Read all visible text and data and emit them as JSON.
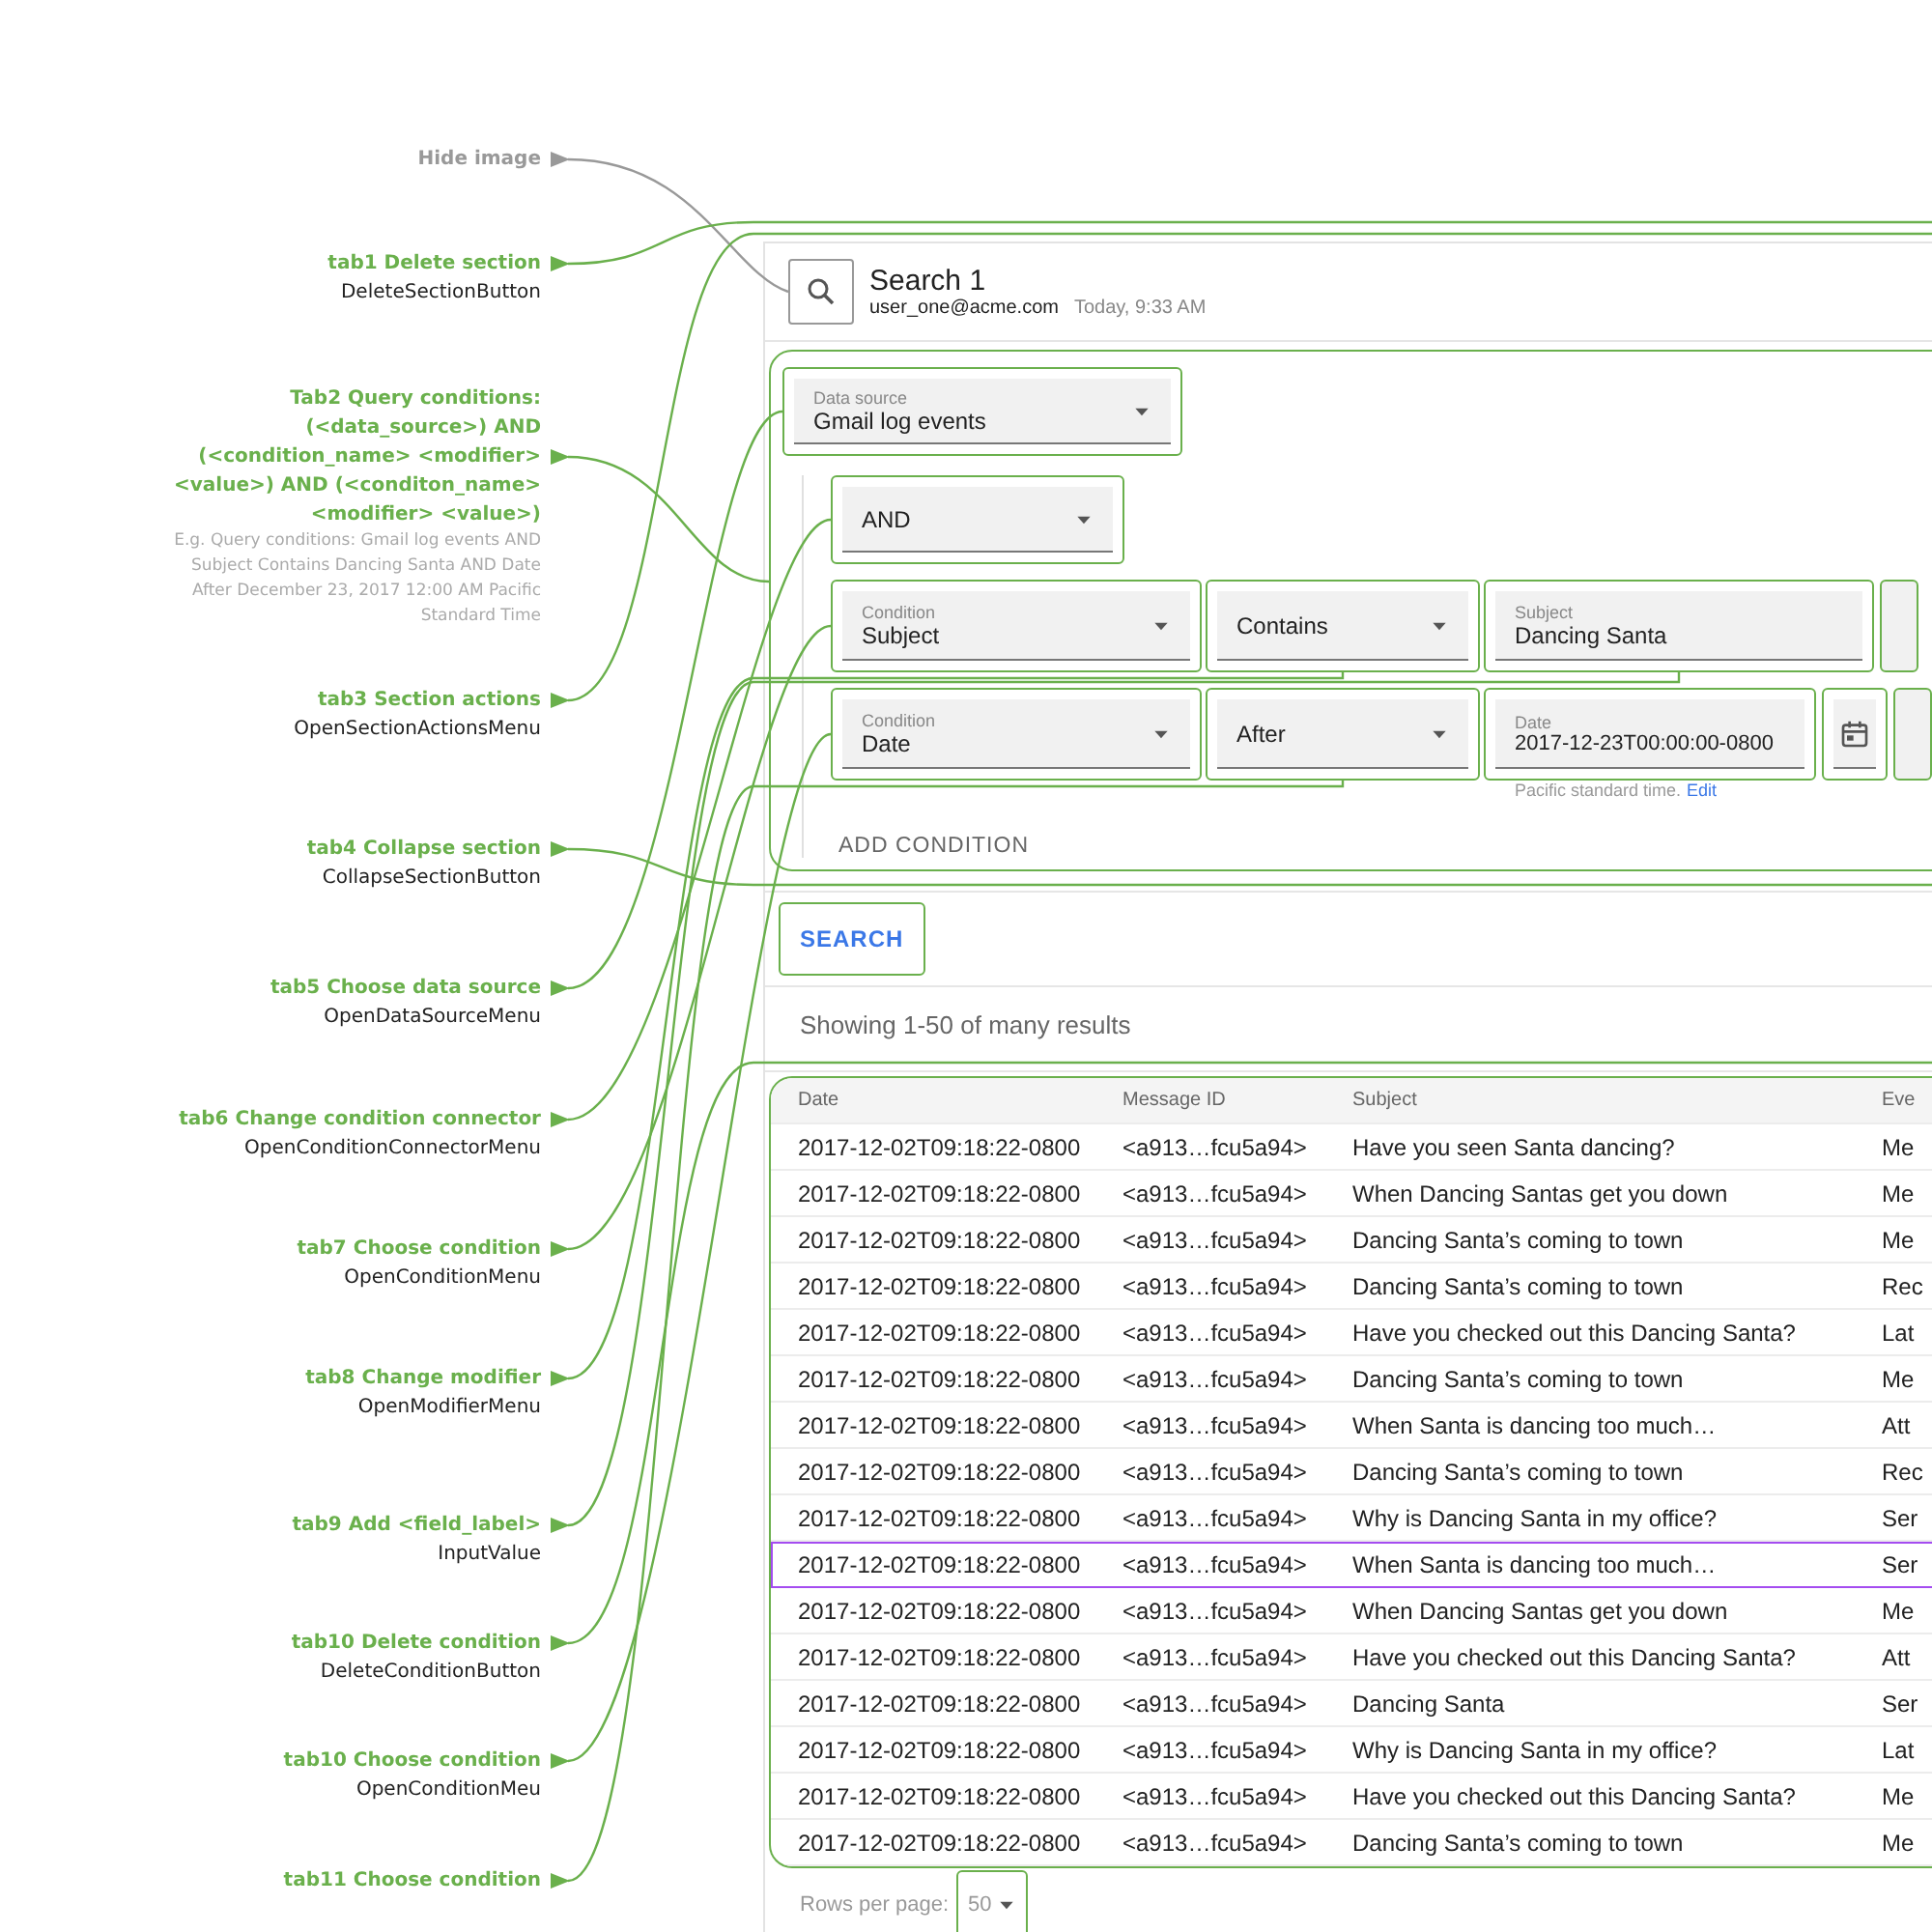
{
  "annotations": [
    {
      "kind": "hint",
      "title": "Hide image"
    },
    {
      "kind": "spec",
      "title": "tab1 Delete section",
      "code": "DeleteSectionButton"
    },
    {
      "kind": "spec",
      "title": "Tab2 Query conditions: (<data_source>) AND (<condition_name> <modifier> <value>) AND (<conditon_name> <modifier> <value>)",
      "description": "E.g. Query conditions: Gmail log events AND Subject Contains Dancing Santa AND Date After December 23, 2017 12:00 AM Pacific Standard Time"
    },
    {
      "kind": "spec",
      "title": "tab3  Section actions",
      "code": "OpenSectionActionsMenu"
    },
    {
      "kind": "spec",
      "title": "tab4 Collapse section",
      "code": "CollapseSectionButton"
    },
    {
      "kind": "spec",
      "title": "tab5 Choose data source",
      "code": "OpenDataSourceMenu"
    },
    {
      "kind": "spec",
      "title": "tab6 Change condition connector",
      "code": "OpenConditionConnectorMenu"
    },
    {
      "kind": "spec",
      "title": "tab7 Choose condition",
      "code": "OpenConditionMenu"
    },
    {
      "kind": "spec",
      "title": "tab8 Change modifier",
      "code": "OpenModifierMenu"
    },
    {
      "kind": "spec",
      "title": "tab9 Add <field_label>",
      "code": "InputValue"
    },
    {
      "kind": "spec",
      "title": "tab10 Delete condition",
      "code": "DeleteConditionButton"
    },
    {
      "kind": "spec",
      "title": "tab10 Choose condition",
      "code": "OpenConditionMeu"
    },
    {
      "kind": "spec",
      "title": "tab11 Choose condition"
    }
  ],
  "search": {
    "title": "Search 1",
    "user": "user_one@acme.com",
    "time": "Today, 9:33 AM"
  },
  "data_source": {
    "label": "Data source",
    "value": "Gmail log events"
  },
  "connector": {
    "value": "AND"
  },
  "conditions": [
    {
      "kind": "text",
      "condition_label": "Condition",
      "condition": "Subject",
      "modifier": "Contains",
      "value_label": "Subject",
      "value": "Dancing Santa"
    },
    {
      "kind": "date",
      "condition_label": "Condition",
      "condition": "Date",
      "modifier": "After",
      "value_label": "Date",
      "value": "2017-12-23T00:00:00-0800",
      "hint": "Pacific standard time.",
      "hint_link": "Edit"
    }
  ],
  "add_condition": "ADD CONDITION",
  "search_button": "SEARCH",
  "results_summary": "Showing 1-50 of many results",
  "table": {
    "columns": [
      "Date",
      "Message ID",
      "Subject",
      "Eve"
    ],
    "rows": [
      {
        "selected": false,
        "cells": [
          "2017-12-02T09:18:22-0800",
          "<a913…fcu5a94>",
          "Have you seen Santa dancing?",
          "Me"
        ]
      },
      {
        "selected": false,
        "cells": [
          "2017-12-02T09:18:22-0800",
          "<a913…fcu5a94>",
          "When Dancing Santas get you down",
          "Me"
        ]
      },
      {
        "selected": false,
        "cells": [
          "2017-12-02T09:18:22-0800",
          "<a913…fcu5a94>",
          "Dancing Santa’s coming to town",
          "Me"
        ]
      },
      {
        "selected": false,
        "cells": [
          "2017-12-02T09:18:22-0800",
          "<a913…fcu5a94>",
          "Dancing Santa’s coming to town",
          "Rec"
        ]
      },
      {
        "selected": false,
        "cells": [
          "2017-12-02T09:18:22-0800",
          "<a913…fcu5a94>",
          "Have you checked out this Dancing Santa?",
          "Lat"
        ]
      },
      {
        "selected": false,
        "cells": [
          "2017-12-02T09:18:22-0800",
          "<a913…fcu5a94>",
          "Dancing Santa’s coming to town",
          "Me"
        ]
      },
      {
        "selected": false,
        "cells": [
          "2017-12-02T09:18:22-0800",
          "<a913…fcu5a94>",
          "When Santa is dancing too much…",
          "Att"
        ]
      },
      {
        "selected": false,
        "cells": [
          "2017-12-02T09:18:22-0800",
          "<a913…fcu5a94>",
          "Dancing Santa’s coming to town",
          "Rec"
        ]
      },
      {
        "selected": false,
        "cells": [
          "2017-12-02T09:18:22-0800",
          "<a913…fcu5a94>",
          "Why is Dancing Santa in my office?",
          "Ser"
        ]
      },
      {
        "selected": true,
        "cells": [
          "2017-12-02T09:18:22-0800",
          "<a913…fcu5a94>",
          "When Santa is dancing too much…",
          "Ser"
        ]
      },
      {
        "selected": false,
        "cells": [
          "2017-12-02T09:18:22-0800",
          "<a913…fcu5a94>",
          "When Dancing Santas get you down",
          "Me"
        ]
      },
      {
        "selected": false,
        "cells": [
          "2017-12-02T09:18:22-0800",
          "<a913…fcu5a94>",
          "Have you checked out this Dancing Santa?",
          "Att"
        ]
      },
      {
        "selected": false,
        "cells": [
          "2017-12-02T09:18:22-0800",
          "<a913…fcu5a94>",
          "Dancing Santa",
          "Ser"
        ]
      },
      {
        "selected": false,
        "cells": [
          "2017-12-02T09:18:22-0800",
          "<a913…fcu5a94>",
          "Why is Dancing Santa in my office?",
          "Lat"
        ]
      },
      {
        "selected": false,
        "cells": [
          "2017-12-02T09:18:22-0800",
          "<a913…fcu5a94>",
          "Have you checked out this Dancing Santa?",
          "Me"
        ]
      },
      {
        "selected": false,
        "cells": [
          "2017-12-02T09:18:22-0800",
          "<a913…fcu5a94>",
          "Dancing Santa’s coming to town",
          "Me"
        ]
      }
    ]
  },
  "pagination": {
    "label": "Rows per page:",
    "value": "50"
  }
}
